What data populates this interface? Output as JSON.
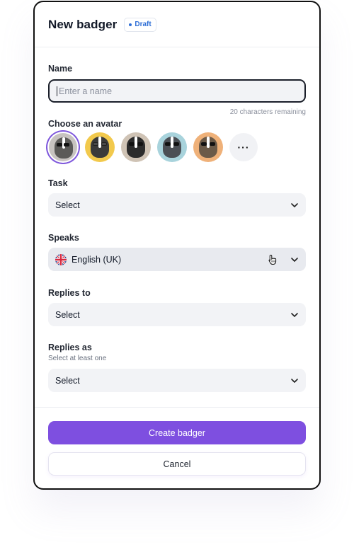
{
  "header": {
    "title": "New badger",
    "status": "Draft"
  },
  "form": {
    "name": {
      "label": "Name",
      "placeholder": "Enter a name",
      "hint": "20 characters remaining"
    },
    "avatar": {
      "label": "Choose an avatar",
      "more_label": "···",
      "options": [
        {
          "name": "avatar-grey",
          "selected": true
        },
        {
          "name": "avatar-yellow",
          "selected": false
        },
        {
          "name": "avatar-suit",
          "selected": false
        },
        {
          "name": "avatar-blue",
          "selected": false
        },
        {
          "name": "avatar-orange",
          "selected": false
        }
      ]
    },
    "task": {
      "label": "Task",
      "value": "Select"
    },
    "speaks": {
      "label": "Speaks",
      "value": "English (UK)",
      "flag": "uk-flag-icon"
    },
    "replies_to": {
      "label": "Replies to",
      "value": "Select"
    },
    "replies_as": {
      "label": "Replies as",
      "sublabel": "Select at least one",
      "value": "Select"
    }
  },
  "actions": {
    "create_label": "Create badger",
    "cancel_label": "Cancel"
  },
  "colors": {
    "accent": "#7e4fe0",
    "badge": "#2f6fd6"
  }
}
